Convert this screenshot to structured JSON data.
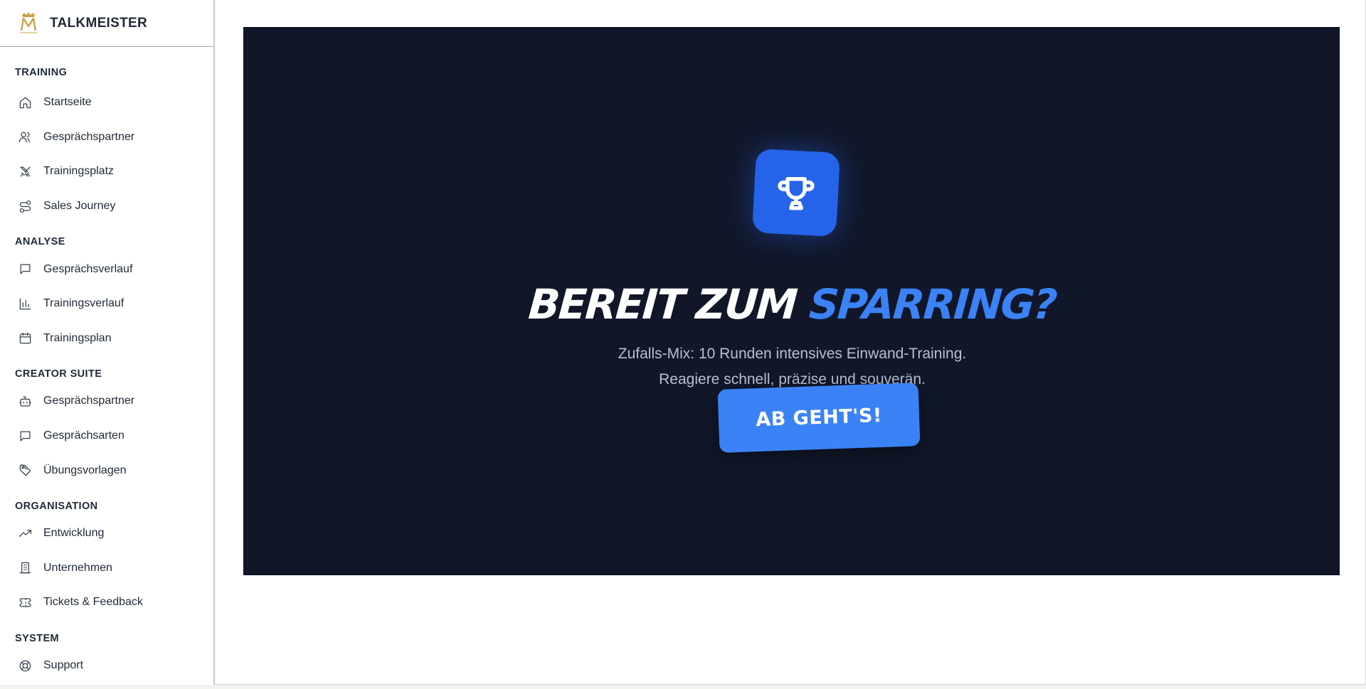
{
  "brand": {
    "name": "TALKMEISTER",
    "logo_icon": "crown-m-logo",
    "accent": "#c9a24a"
  },
  "sidebar": {
    "sections": [
      {
        "title": "TRAINING",
        "items": [
          {
            "label": "Startseite",
            "icon": "home-icon"
          },
          {
            "label": "Gesprächspartner",
            "icon": "users-icon"
          },
          {
            "label": "Trainingsplatz",
            "icon": "swords-icon"
          },
          {
            "label": "Sales Journey",
            "icon": "route-icon"
          }
        ]
      },
      {
        "title": "ANALYSE",
        "items": [
          {
            "label": "Gesprächsverlauf",
            "icon": "message-icon"
          },
          {
            "label": "Trainingsverlauf",
            "icon": "bar-chart-icon"
          },
          {
            "label": "Trainingsplan",
            "icon": "calendar-icon"
          }
        ]
      },
      {
        "title": "CREATOR SUITE",
        "items": [
          {
            "label": "Gesprächspartner",
            "icon": "bot-icon"
          },
          {
            "label": "Gesprächsarten",
            "icon": "message-icon"
          },
          {
            "label": "Übungsvorlagen",
            "icon": "tag-icon"
          }
        ]
      },
      {
        "title": "ORGANISATION",
        "items": [
          {
            "label": "Entwicklung",
            "icon": "trending-up-icon"
          },
          {
            "label": "Unternehmen",
            "icon": "building-icon"
          },
          {
            "label": "Tickets & Feedback",
            "icon": "ticket-icon"
          }
        ]
      },
      {
        "title": "SYSTEM",
        "items": [
          {
            "label": "Support",
            "icon": "lifebuoy-icon"
          }
        ]
      }
    ]
  },
  "hero": {
    "icon": "trophy-icon",
    "headline_part1": "BEREIT ZUM ",
    "headline_part2": "SPARRING?",
    "subtext_line1": "Zufalls-Mix: 10 Runden intensives Einwand-Training.",
    "subtext_line2": "Reagiere schnell, präzise und souverän.",
    "cta_label": "AB GEHT'S!",
    "colors": {
      "background": "#111729",
      "accent": "#3b82f6",
      "icon_bg": "#2563eb"
    }
  }
}
